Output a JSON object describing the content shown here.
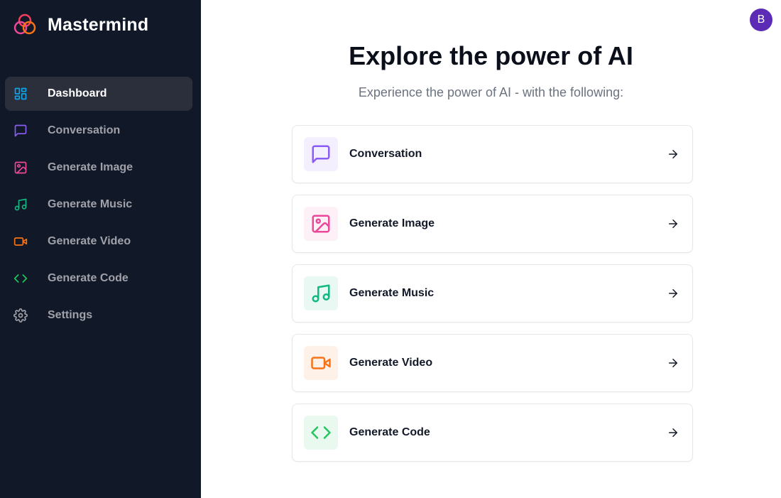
{
  "brand": {
    "name": "Mastermind",
    "icon": "mastermind-logo"
  },
  "sidebar": {
    "items": [
      {
        "label": "Dashboard",
        "icon": "dashboard-icon",
        "color": "#0ea5e9",
        "active": true
      },
      {
        "label": "Conversation",
        "icon": "message-square-icon",
        "color": "#8b5cf6"
      },
      {
        "label": "Generate Image",
        "icon": "image-icon",
        "color": "#ec4899"
      },
      {
        "label": "Generate Music",
        "icon": "music-icon",
        "color": "#10b981"
      },
      {
        "label": "Generate Video",
        "icon": "video-icon",
        "color": "#f97316"
      },
      {
        "label": "Generate Code",
        "icon": "code-icon",
        "color": "#22c55e"
      },
      {
        "label": "Settings",
        "icon": "settings-icon",
        "color": "#a1a1aa"
      }
    ]
  },
  "header": {
    "avatar_initial": "B",
    "avatar_color": "#5b2bb5"
  },
  "main": {
    "title": "Explore the power of AI",
    "subtitle": "Experience the power of AI - with the following:",
    "cards": [
      {
        "label": "Conversation",
        "icon": "message-square-icon",
        "color": "#8b5cf6",
        "bg": "#f3effe"
      },
      {
        "label": "Generate Image",
        "icon": "image-icon",
        "color": "#ec4899",
        "bg": "#fdf0f6"
      },
      {
        "label": "Generate Music",
        "icon": "music-icon",
        "color": "#10b981",
        "bg": "#e9f8f2"
      },
      {
        "label": "Generate Video",
        "icon": "video-icon",
        "color": "#f97316",
        "bg": "#fef2e8"
      },
      {
        "label": "Generate Code",
        "icon": "code-icon",
        "color": "#22c55e",
        "bg": "#eaf9ef"
      }
    ]
  }
}
